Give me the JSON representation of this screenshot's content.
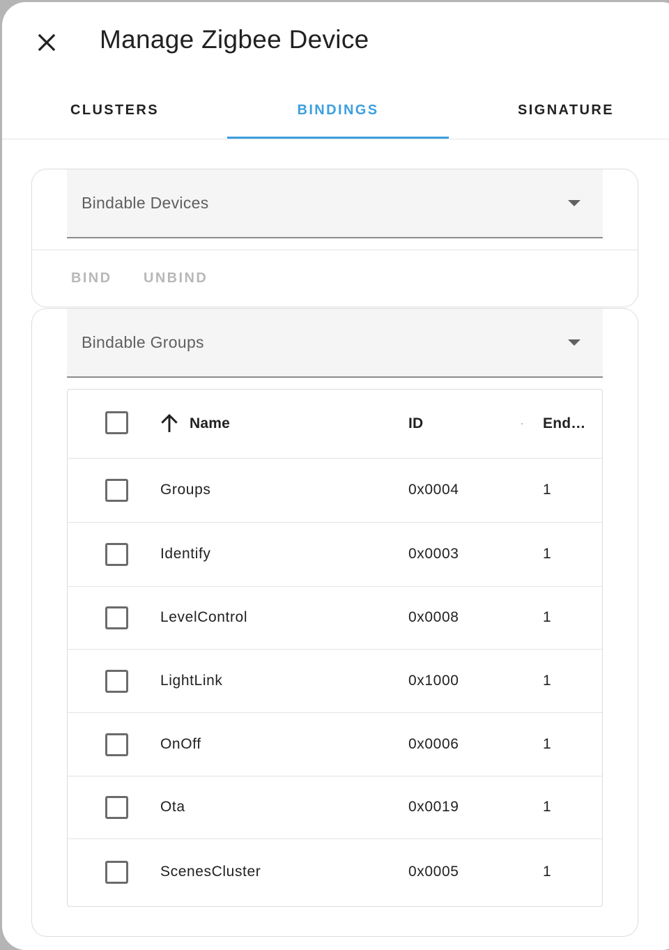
{
  "dialog": {
    "title": "Manage Zigbee Device"
  },
  "tabs": [
    {
      "label": "CLUSTERS"
    },
    {
      "label": "BINDINGS"
    },
    {
      "label": "SIGNATURE"
    }
  ],
  "active_tab": "BINDINGS",
  "colors": {
    "accent": "#3d9fe0",
    "text": "#212121",
    "disabled": "#b8b8b8"
  },
  "devices_card": {
    "select_label": "Bindable Devices",
    "bind_label": "BIND",
    "unbind_label": "UNBIND"
  },
  "groups_card": {
    "select_label": "Bindable Groups",
    "table": {
      "columns": [
        "Name",
        "ID",
        "End…"
      ],
      "sort_column": "Name",
      "sort_direction": "ascending",
      "rows": [
        {
          "name": "Groups",
          "id": "0x0004",
          "endpoint": "1",
          "checked": false
        },
        {
          "name": "Identify",
          "id": "0x0003",
          "endpoint": "1",
          "checked": false
        },
        {
          "name": "LevelControl",
          "id": "0x0008",
          "endpoint": "1",
          "checked": false
        },
        {
          "name": "LightLink",
          "id": "0x1000",
          "endpoint": "1",
          "checked": false
        },
        {
          "name": "OnOff",
          "id": "0x0006",
          "endpoint": "1",
          "checked": false
        },
        {
          "name": "Ota",
          "id": "0x0019",
          "endpoint": "1",
          "checked": false
        },
        {
          "name": "ScenesCluster",
          "id": "0x0005",
          "endpoint": "1",
          "checked": false
        }
      ]
    }
  }
}
